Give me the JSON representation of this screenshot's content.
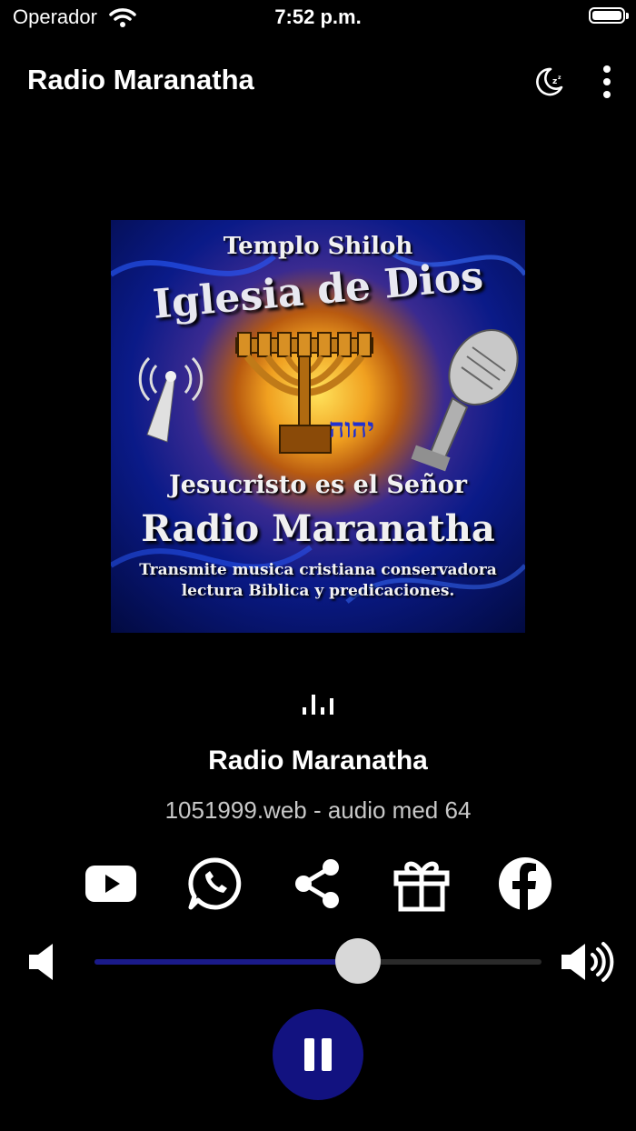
{
  "status_bar": {
    "carrier": "Operador",
    "time": "7:52 p.m."
  },
  "header": {
    "title": "Radio Maranatha",
    "sleep_icon": "sleep-timer-moon-icon",
    "menu_icon": "more-vertical-icon"
  },
  "album_art": {
    "line1": "Templo Shiloh",
    "line2": "Iglesia de Dios",
    "hebrew": "יהוה",
    "line3": "Jesucristo es el Señor",
    "line4": "Radio Maranatha",
    "line5": "Transmite musica cristiana conservadora",
    "line6": "lectura Biblica y predicaciones."
  },
  "now_playing": {
    "station": "Radio Maranatha",
    "stream_info": "1051999.web - audio med 64"
  },
  "social": [
    {
      "icon": "youtube-icon"
    },
    {
      "icon": "whatsapp-icon"
    },
    {
      "icon": "share-icon"
    },
    {
      "icon": "gift-icon"
    },
    {
      "icon": "facebook-icon"
    }
  ],
  "volume": {
    "level": 0.59
  },
  "colors": {
    "background": "#000000",
    "accent": "#121280",
    "slider_fill": "#1a1a8a",
    "slider_thumb": "#d8d8d8"
  }
}
